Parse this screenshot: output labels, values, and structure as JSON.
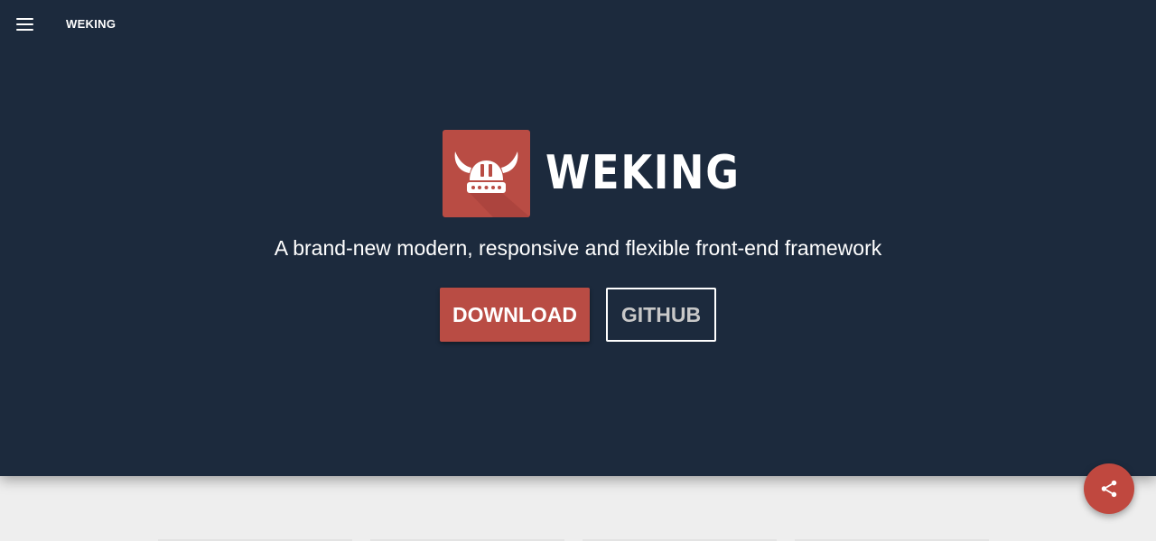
{
  "header": {
    "menu_icon": "hamburger-icon",
    "brand": "WEKING"
  },
  "hero": {
    "logo_icon": "viking-helmet-icon",
    "logo_text": "WEKING",
    "tagline": "A brand-new modern, responsive and flexible front-end framework",
    "download_label": "DOWNLOAD",
    "github_label": "GITHUB"
  },
  "fab": {
    "icon": "share-icon"
  },
  "colors": {
    "hero_bg": "#1c2a3d",
    "accent": "#b94c44",
    "page_bg": "#eeeeee"
  }
}
